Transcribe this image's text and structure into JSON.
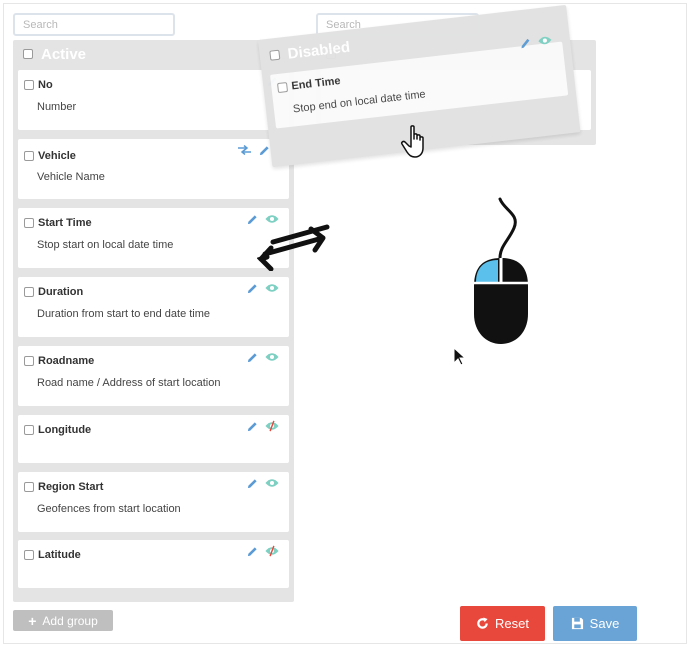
{
  "search": {
    "left_placeholder": "Search",
    "right_placeholder": "Search"
  },
  "active_group": {
    "title": "Active",
    "items": [
      {
        "title": "No",
        "desc": "Number"
      },
      {
        "title": "Vehicle",
        "desc": "Vehicle Name"
      },
      {
        "title": "Start Time",
        "desc": "Stop start on local date time"
      },
      {
        "title": "Duration",
        "desc": "Duration from start to end date time"
      },
      {
        "title": "Roadname",
        "desc": "Road name / Address of start location"
      },
      {
        "title": "Longitude",
        "desc": ""
      },
      {
        "title": "Region Start",
        "desc": "Geofences from start location"
      },
      {
        "title": "Latitude",
        "desc": ""
      }
    ]
  },
  "disabled_group": {
    "title": "Disabled",
    "items": [
      {
        "title": "End Time",
        "desc": "Stop end on local date time"
      }
    ]
  },
  "buttons": {
    "add_group": "Add group",
    "reset": "Reset",
    "save": "Save"
  },
  "icons": {
    "edit": "pencil-icon",
    "visible": "eye-icon",
    "hidden": "eye-slash-icon",
    "move": "arrows-horizontal-icon",
    "cursor_hand": "hand-pointer-icon",
    "mouse": "mouse-icon",
    "swap": "swap-arrows-icon"
  },
  "colors": {
    "accent_blue": "#5b9bd5",
    "eye_teal": "#7dd0c2",
    "reset_red": "#e8473c",
    "save_blue": "#6aa3d5",
    "mouse_highlight": "#5bc0eb"
  }
}
